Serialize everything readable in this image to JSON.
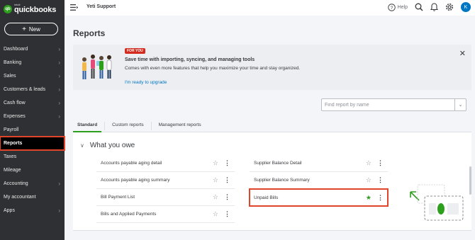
{
  "brand": {
    "badge": "qb",
    "intuit": "intuit",
    "name": "quickbooks",
    "color": "#2ca01c"
  },
  "new_button": {
    "plus": "+",
    "label": "New"
  },
  "sidebar": {
    "items": [
      {
        "label": "Dashboard",
        "chevron": true
      },
      {
        "label": "Banking",
        "chevron": true
      },
      {
        "label": "Sales",
        "chevron": true
      },
      {
        "label": "Customers & leads",
        "chevron": true
      },
      {
        "label": "Cash flow",
        "chevron": true
      },
      {
        "label": "Expenses",
        "chevron": true
      },
      {
        "label": "Payroll",
        "chevron": false
      },
      {
        "label": "Reports",
        "chevron": false,
        "active": true
      },
      {
        "label": "Taxes",
        "chevron": false
      },
      {
        "label": "Mileage",
        "chevron": false
      },
      {
        "label": "Accounting",
        "chevron": true
      },
      {
        "label": "My accountant",
        "chevron": false
      },
      {
        "label": "Apps",
        "chevron": true
      }
    ]
  },
  "header": {
    "company": "Yeti Support",
    "help_label": "Help",
    "avatar_initial": "K"
  },
  "page": {
    "title": "Reports"
  },
  "banner": {
    "badge": "FOR YOU",
    "title": "Save time with importing, syncing, and managing tools",
    "description": "Comes with even more features that help you maximize your time and stay organized.",
    "link": "I'm ready to upgrade",
    "close": "✕"
  },
  "search": {
    "placeholder": "Find report by name"
  },
  "tabs": [
    {
      "label": "Standard",
      "active": true
    },
    {
      "label": "Custom reports",
      "active": false
    },
    {
      "label": "Management reports",
      "active": false
    }
  ],
  "section": {
    "title": "What you owe",
    "left": [
      {
        "label": "Accounts payable aging detail",
        "favorite": false
      },
      {
        "label": "Accounts payable aging summary",
        "favorite": false
      },
      {
        "label": "Bill Payment List",
        "favorite": false
      },
      {
        "label": "Bills and Applied Payments",
        "favorite": false
      }
    ],
    "right": [
      {
        "label": "Supplier Balance Detail",
        "favorite": false
      },
      {
        "label": "Supplier Balance Summary",
        "favorite": false
      },
      {
        "label": "Unpaid Bills",
        "favorite": true,
        "highlighted": true
      }
    ]
  },
  "colors": {
    "accent_green": "#2ca01c",
    "highlight_red": "#e0452b",
    "link_blue": "#0077c5",
    "sidebar_bg": "#2f3033"
  }
}
